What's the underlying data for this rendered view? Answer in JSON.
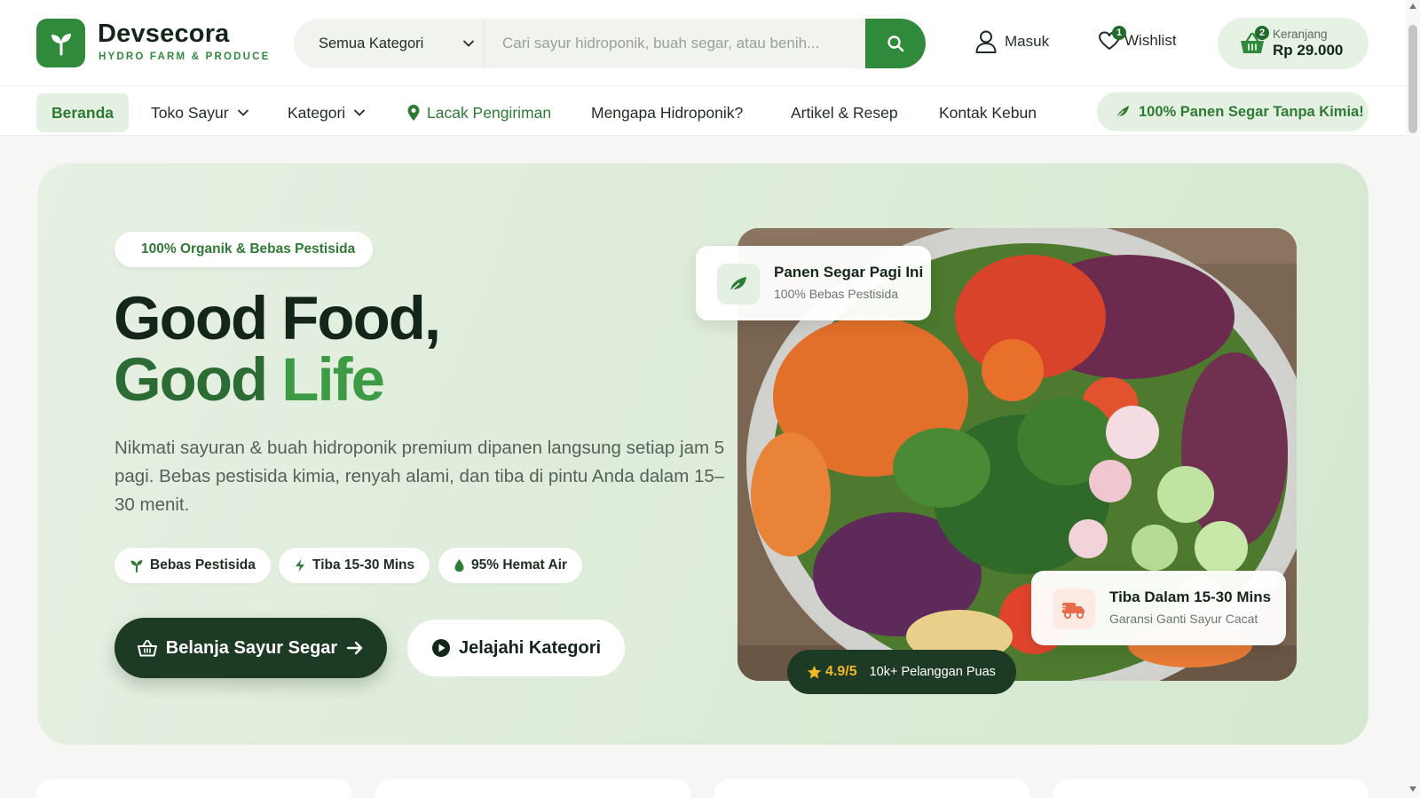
{
  "brand": {
    "name": "Devsecora",
    "tagline": "HYDRO FARM & PRODUCE",
    "logo_icon": "sprout-icon"
  },
  "search": {
    "category": "Semua Kategori",
    "placeholder": "Cari sayur hidroponik, buah segar, atau benih...",
    "value": ""
  },
  "header": {
    "login": "Masuk",
    "wishlist": {
      "label": "Wishlist",
      "count": "1"
    },
    "cart": {
      "label": "Keranjang",
      "amount": "Rp 29.000",
      "count": "2"
    }
  },
  "nav": {
    "items": [
      "Beranda",
      "Toko Sayur",
      "Kategori",
      "Lacak Pengiriman",
      "Mengapa Hidroponik?",
      "Artikel & Resep",
      "Kontak Kebun"
    ],
    "promo": "100% Panen Segar Tanpa Kimia!"
  },
  "hero": {
    "pill": "100% Organik & Bebas Pestisida",
    "title_line1": "Good Food,",
    "title_word1": "Good",
    "title_word2": "Life",
    "description": "Nikmati sayuran & buah hidroponik premium dipanen langsung setiap jam 5 pagi. Bebas pestisida kimia, renyah alami, dan tiba di pintu Anda dalam 15–30 menit.",
    "features": [
      "Bebas Pestisida",
      "Tiba 15-30 Mins",
      "95% Hemat Air"
    ],
    "cta_primary": "Belanja Sayur Segar",
    "cta_secondary": "Jelajahi Kategori",
    "card_harvest": {
      "title": "Panen Segar Pagi Ini",
      "subtitle": "100% Bebas Pestisida"
    },
    "card_delivery": {
      "title": "Tiba Dalam 15-30 Mins",
      "subtitle": "Garansi Ganti Sayur Cacat"
    },
    "rating": {
      "score": "4.9/5",
      "text": "10k+ Pelanggan Puas"
    }
  },
  "colors": {
    "primary": "#2f8a3b",
    "dark": "#1d3a25",
    "accent_soft": "#e4f0e1",
    "star": "#f5b726"
  }
}
